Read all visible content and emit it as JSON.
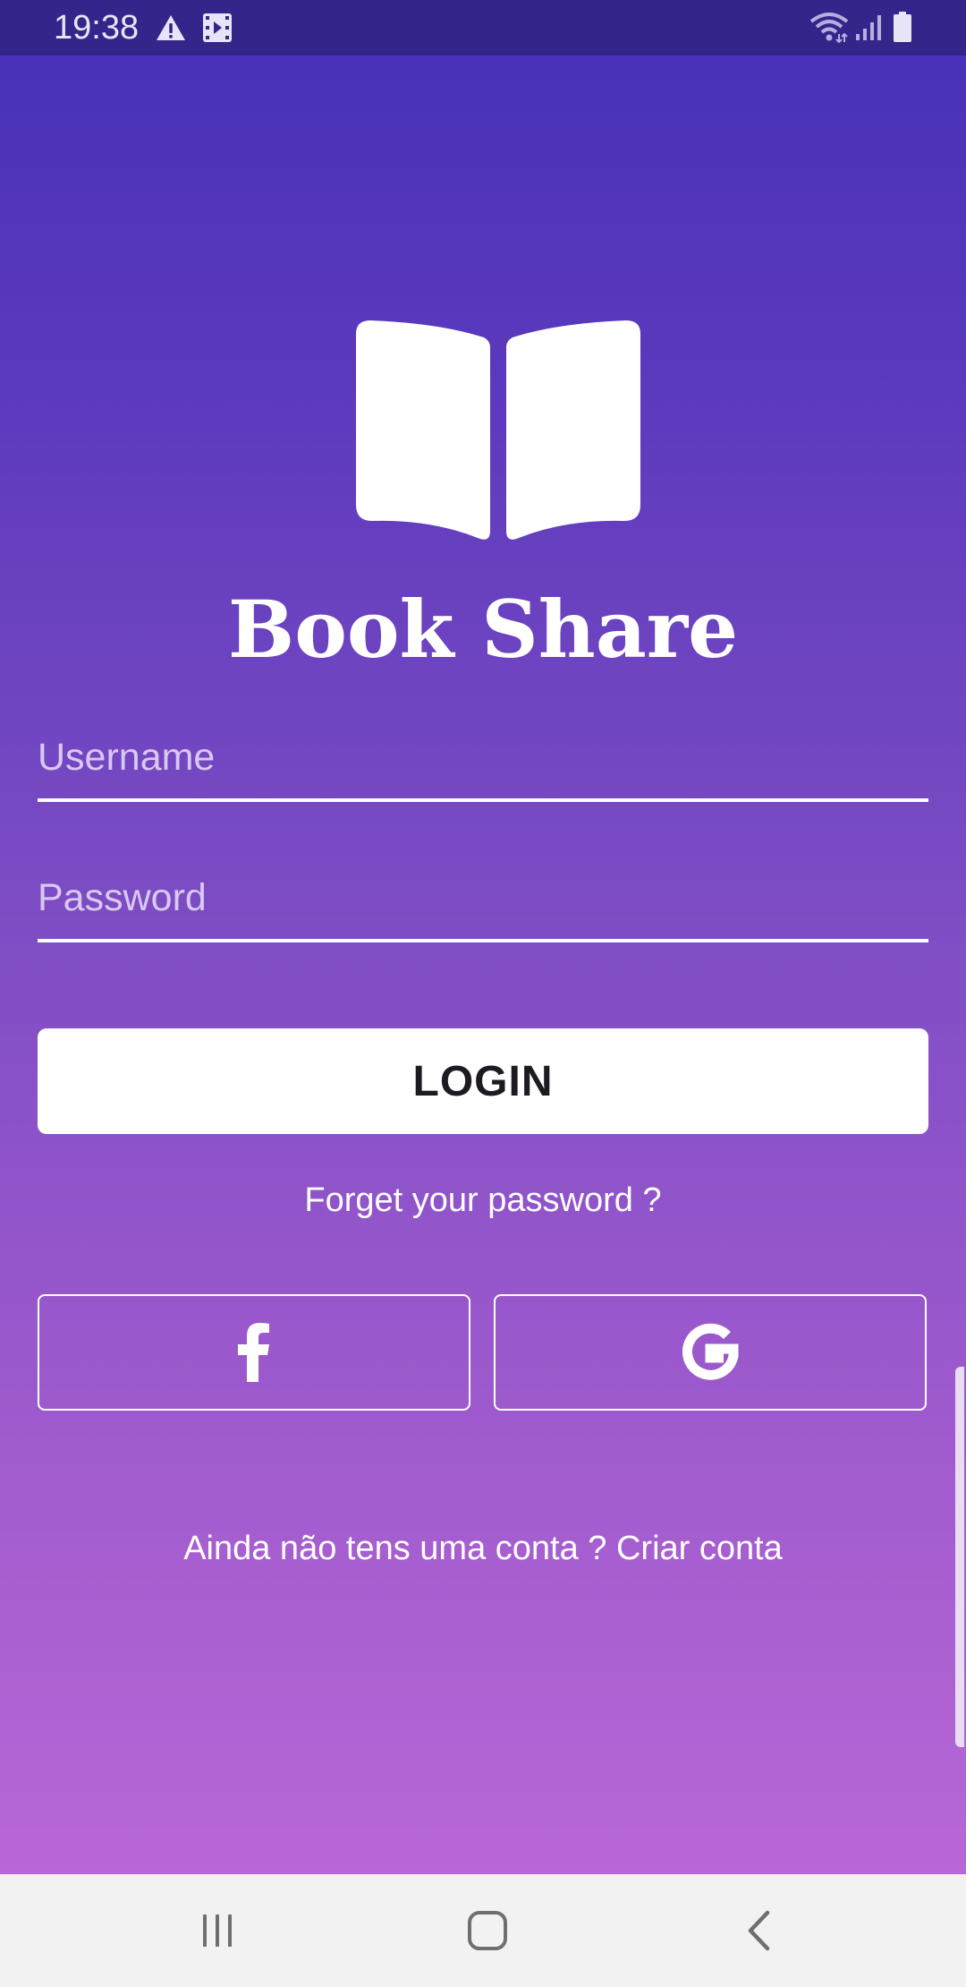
{
  "status_bar": {
    "time": "19:38",
    "left_icons": [
      "warning-icon",
      "media-icon"
    ],
    "right_icons": [
      "wifi-icon",
      "signal-icon",
      "battery-icon"
    ]
  },
  "app": {
    "logo_icon": "open-book-icon",
    "title": "Book Share"
  },
  "form": {
    "username": {
      "value": "",
      "placeholder": "Username"
    },
    "password": {
      "value": "",
      "placeholder": "Password"
    },
    "login_label": "LOGIN",
    "forgot_label": "Forget your password ?"
  },
  "social": [
    {
      "name": "facebook",
      "icon": "facebook-icon"
    },
    {
      "name": "google",
      "icon": "google-icon"
    }
  ],
  "signup": {
    "prompt": "Ainda não tens uma conta ?",
    "link": "Criar conta"
  },
  "nav_bar": {
    "buttons": [
      "recent-apps-icon",
      "home-icon",
      "back-icon"
    ]
  },
  "colors": {
    "status_bar": "#33258a",
    "gradient_top": "#4630b7",
    "gradient_bottom": "#b867d6",
    "nav_bar": "#f2f2f2",
    "button_text": "#1d1a22",
    "placeholder": "#d9c9f0"
  }
}
